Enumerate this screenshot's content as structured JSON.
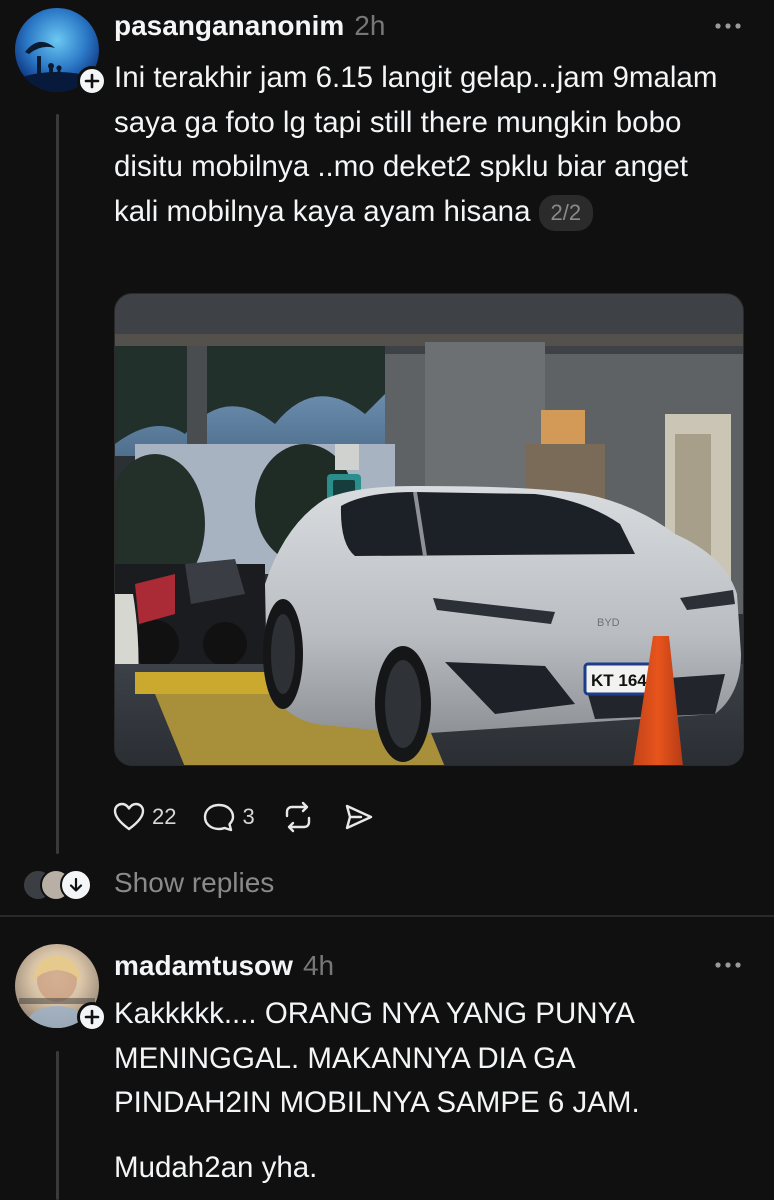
{
  "posts": [
    {
      "username": "pasangananonim",
      "time": "2h",
      "text": "Ini terakhir jam 6.15 langit gelap...jam 9malam saya ga foto lg tapi still there mungkin bobo disitu mobilnya ..mo deket2 spklu biar anget kali mobilnya kaya ayam hisana",
      "page_indicator": "2/2",
      "image_plate": "KT 1642",
      "image_brand_badge": "BYD",
      "likes": "22",
      "replies": "3",
      "show_replies": "Show replies"
    },
    {
      "username": "madamtusow",
      "time": "4h",
      "text": "Kakkkkk.... ORANG NYA YANG PUNYA MENINGGAL. MAKANNYA DIA GA PINDAH2IN MOBILNYA SAMPE 6 JAM.",
      "text2": "Mudah2an yha."
    }
  ],
  "icons": {
    "more": "more-horizontal-icon",
    "like": "heart-icon",
    "comment": "comment-icon",
    "repost": "repost-icon",
    "share": "share-icon",
    "follow": "plus-icon",
    "expand": "arrow-down-icon"
  },
  "colors": {
    "background": "#101010",
    "text": "#f3f5f7",
    "muted": "#777777",
    "cone": "#e8541c"
  }
}
